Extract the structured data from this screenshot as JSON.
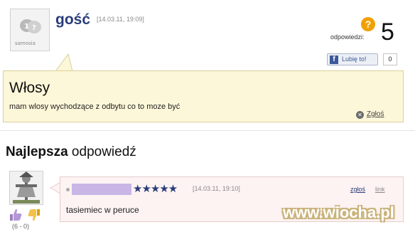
{
  "question": {
    "avatar_label": "samosia",
    "author": "gość",
    "date": "[14.03.11, 19:09]",
    "answers_label": "odpowiedzi:",
    "answers_count": "5",
    "badge_icon": "question-icon",
    "title": "Włosy",
    "body": "mam wlosy wychodzące z odbytu co to moze być",
    "report_label": "Zgłoś"
  },
  "like": {
    "label": "Lubię to!",
    "count": "0"
  },
  "best_answer": {
    "heading_bold": "Najlepsza",
    "heading_rest": " odpowiedź",
    "stars": "★★★★★",
    "date": "[14.03.11, 19:10]",
    "report_label": "zgłoś",
    "link_label": "link",
    "text": "tasiemiec w peruce",
    "votes": "(6 - 0)"
  },
  "watermark": "www.wiocha.pl",
  "colors": {
    "accent": "#2a3c7a",
    "question_bg": "#fdf7d9",
    "answer_bg": "#fdf3f3",
    "badge": "#f0a000",
    "facebook": "#3b5998"
  }
}
